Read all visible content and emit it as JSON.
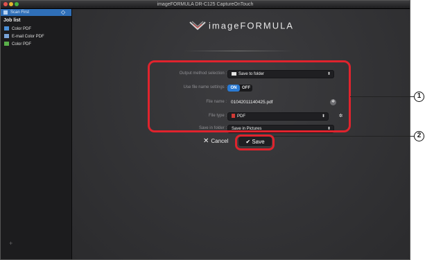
{
  "window": {
    "title": "imageFORMULA DR-C125 CaptureOnTouch"
  },
  "sidebar": {
    "scan_first_label": "Scan First",
    "joblist_title": "Job list",
    "jobs": [
      {
        "label": "Color PDF",
        "icon": "folder-icon",
        "color": "#4a90d9"
      },
      {
        "label": "E-mail Color PDF",
        "icon": "mail-icon",
        "color": "#7aa4d9"
      },
      {
        "label": "Color PDF",
        "icon": "image-icon",
        "color": "#59b04a"
      }
    ],
    "add_label": "+"
  },
  "main": {
    "logo_text": "imageFORMULA",
    "fields": {
      "output_method_label": "Output method selection :",
      "output_method_value": "Save to folder",
      "use_file_name_label": "Use file name settings :",
      "toggle_on": "ON",
      "toggle_off": "OFF",
      "file_name_label": "File name :",
      "file_name_value": "01042011140425.pdf",
      "file_type_label": "File type :",
      "file_type_value": "PDF",
      "save_in_folder_label": "Save in folder :",
      "save_in_folder_value": "Save in Pictures"
    },
    "cancel_label": "Cancel",
    "save_label": "Save"
  },
  "callouts": [
    "1",
    "2"
  ],
  "colors": {
    "accent": "#2a7ad3",
    "highlight": "#e0232d",
    "pdf": "#d23a35"
  }
}
